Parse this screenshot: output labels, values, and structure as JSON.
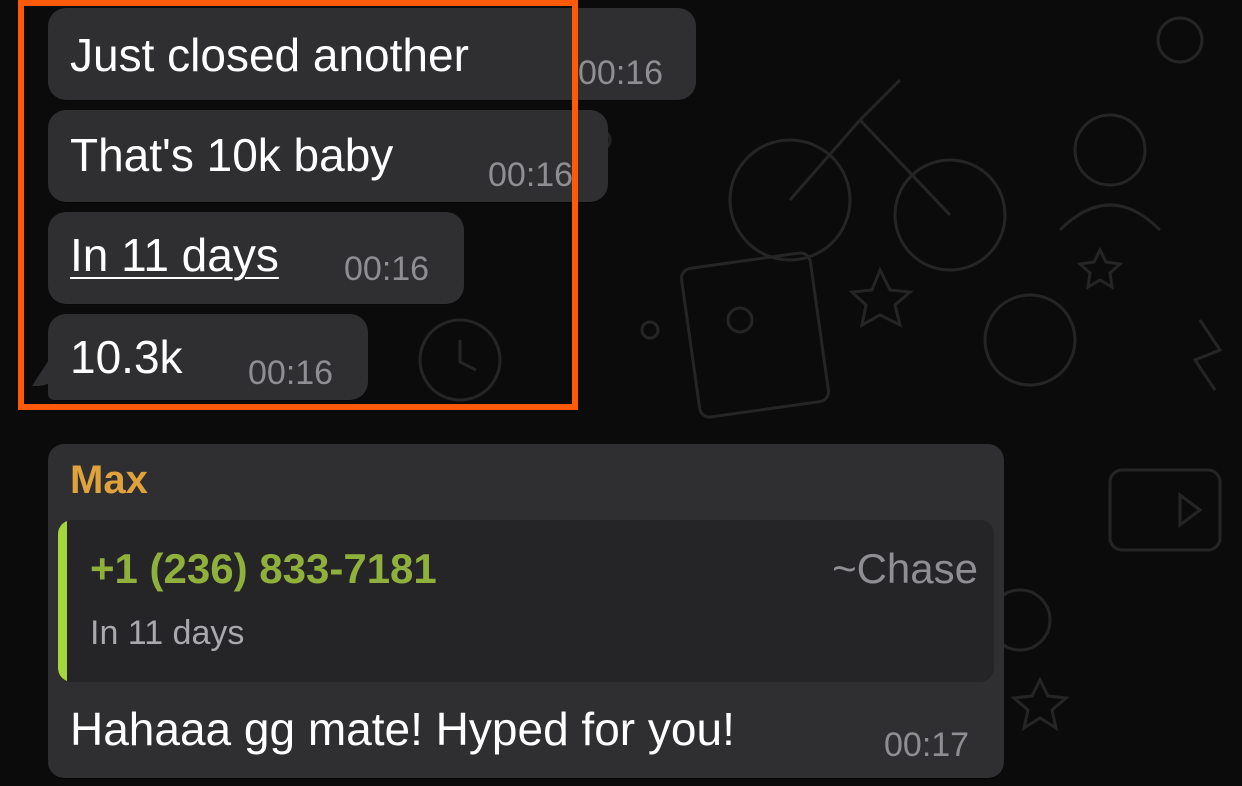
{
  "colors": {
    "bubble": "#2f2f31",
    "highlight": "#ff5a0a",
    "sender_name": "#e0a33c",
    "quote_name": "#8fb13c",
    "quote_bar": "#a5d63a",
    "timestamp": "#8f8f93"
  },
  "messages": [
    {
      "text": "Just closed another",
      "time": "00:16"
    },
    {
      "text": "That's 10k baby",
      "time": "00:16"
    },
    {
      "text": "In 11 days",
      "time": "00:16"
    },
    {
      "text": "10.3k",
      "time": "00:16"
    }
  ],
  "reply": {
    "sender": "Max",
    "quoted": {
      "name": "+1 (236) 833-7181",
      "alias": "~Chase",
      "text": "In 11 days"
    },
    "text": "Hahaaa gg mate! Hyped for you!",
    "time": "00:17"
  }
}
